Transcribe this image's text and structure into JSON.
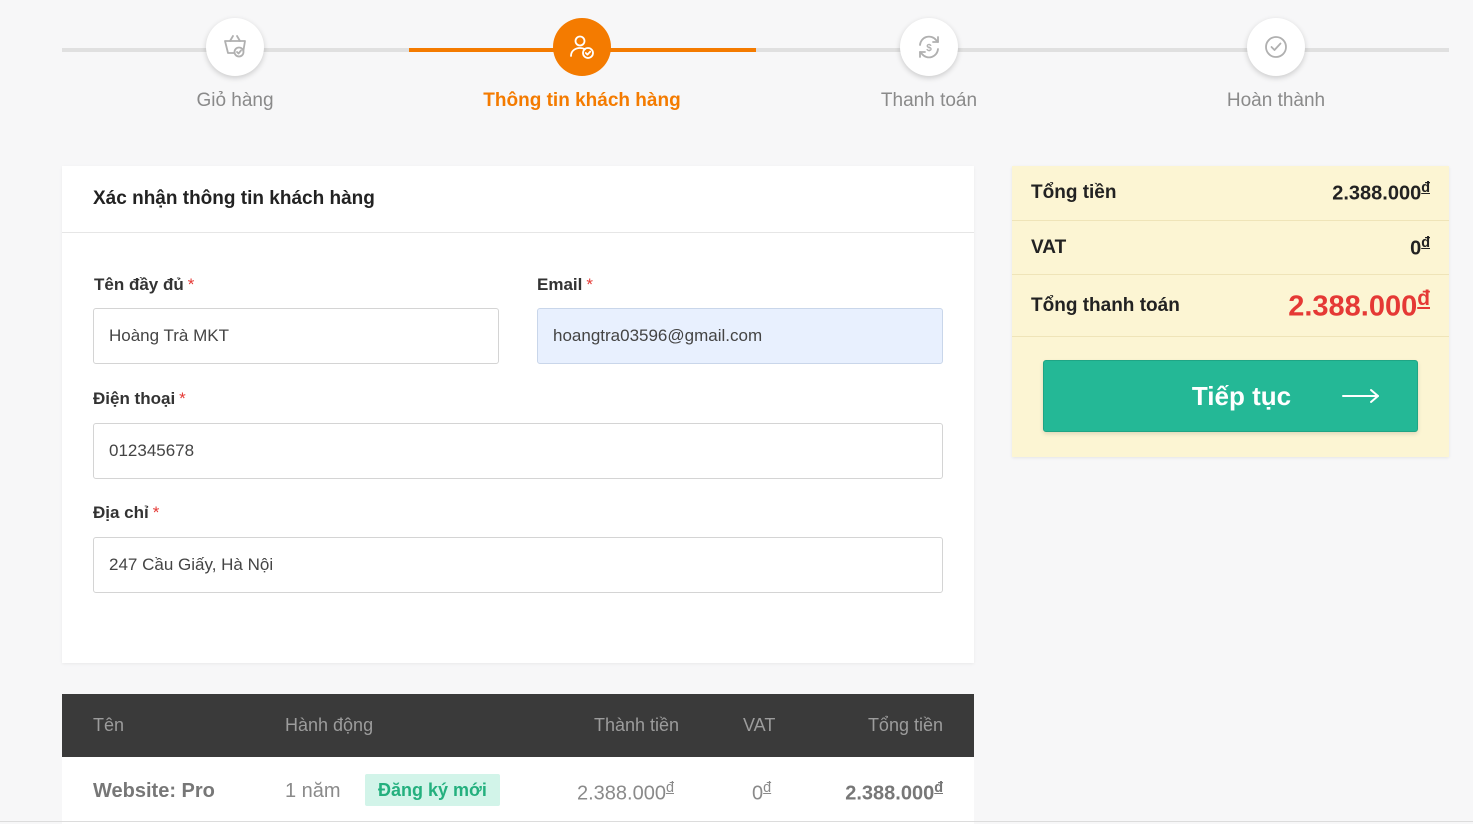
{
  "stepper": {
    "steps": [
      {
        "label": "Giỏ hàng",
        "icon": "cart-check-icon"
      },
      {
        "label": "Thông tin khách hàng",
        "icon": "user-check-icon"
      },
      {
        "label": "Thanh toán",
        "icon": "payment-cycle-icon"
      },
      {
        "label": "Hoàn thành",
        "icon": "check-circle-icon"
      }
    ],
    "current_index": 1
  },
  "form": {
    "title": "Xác nhận thông tin khách hàng",
    "required_mark": "*",
    "name_label": "Tên đầy đủ",
    "name_value": "Hoàng Trà MKT",
    "email_label": "Email",
    "email_value": "hoangtra03596@gmail.com",
    "phone_label": "Điện thoại",
    "phone_value": "012345678",
    "address_label": "Địa chỉ",
    "address_value": "247 Cầu Giấy, Hà Nội"
  },
  "summary": {
    "total_label": "Tổng tiền",
    "total_value": "2.388.000",
    "vat_label": "VAT",
    "vat_value": "0",
    "grand_label": "Tổng thanh toán",
    "grand_value": "2.388.000",
    "currency": "đ",
    "continue_label": "Tiếp tục"
  },
  "table": {
    "headers": {
      "name": "Tên",
      "action": "Hành động",
      "subtotal": "Thành tiền",
      "vat": "VAT",
      "total": "Tổng tiền"
    },
    "rows": [
      {
        "name": "Website: Pro",
        "period": "1 năm",
        "action": "Đăng ký mới",
        "subtotal": "2.388.000",
        "vat": "0",
        "total": "2.388.000"
      }
    ]
  },
  "colors": {
    "accent": "#f47b00",
    "primary_button": "#24b896",
    "summary_bg": "#fcf5d3",
    "grand_total": "#e53935",
    "table_header": "#3a3a3a"
  }
}
